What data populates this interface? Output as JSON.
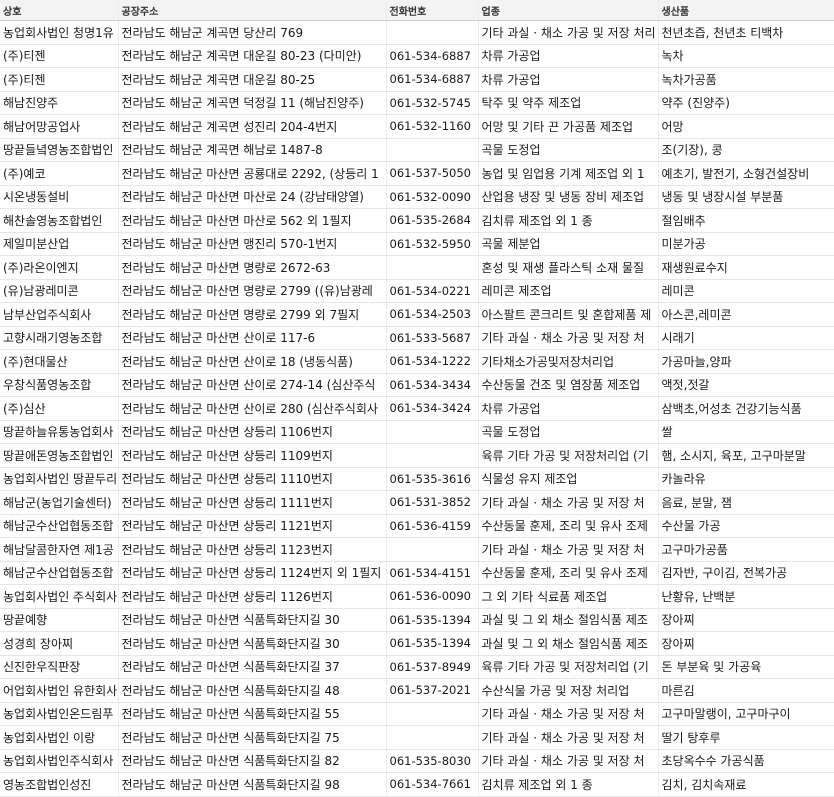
{
  "headers": [
    "상호",
    "공장주소",
    "전화번호",
    "업종",
    "생산품"
  ],
  "rows": [
    [
      "농업회사법인 청명1유",
      "전라남도 해남군 계곡면 당산리 769",
      "",
      "기타 과실 · 채소 가공 및 저장 처리",
      "천년초즙, 천년초 티백차"
    ],
    [
      "(주)티젠",
      "전라남도 해남군 계곡면 대운길 80-23 (다미안)",
      "061-534-6887",
      "차류 가공업",
      "녹차"
    ],
    [
      "(주)티젠",
      "전라남도 해남군 계곡면 대운길 80-25",
      "061-534-6887",
      "차류 가공업",
      "녹차가공품"
    ],
    [
      "해남진양주",
      "전라남도 해남군 계곡면 덕정길 11 (해남진양주)",
      "061-532-5745",
      "탁주 및 약주 제조업",
      "약주 (진양주)"
    ],
    [
      "해남어망공업사",
      "전라남도 해남군 계곡면 성진리 204-4번지",
      "061-532-1160",
      "어망 및 기타 끈 가공품 제조업",
      "어망"
    ],
    [
      "땅끝들녘영농조합법인",
      "전라남도 해남군 계곡면 해남로 1487-8",
      "",
      "곡물 도정업",
      "조(기장), 콩"
    ],
    [
      "(주)예코",
      "전라남도 해남군 마산면 공룡대로 2292, (상등리 1",
      "061-537-5050",
      "농업 및 임업용 기계 제조업 외 1",
      "예초기, 발전기, 소형건설장비"
    ],
    [
      "시온냉동설비",
      "전라남도 해남군 마산면 마산로 24 (강남태양열)",
      "061-532-0090",
      "산업용 냉장 및 냉동 장비 제조업",
      "냉동 및 냉장시설 부분품"
    ],
    [
      "해찬솔영농조합법인",
      "전라남도 해남군 마산면 마산로 562 외 1필지",
      "061-535-2684",
      "김치류 제조업 외 1 종",
      "절임배추"
    ],
    [
      "제일미분산업",
      "전라남도 해남군 마산면 맹진리 570-1번지",
      "061-532-5950",
      "곡물 제분업",
      "미분가공"
    ],
    [
      "(주)라온이엔지",
      "전라남도 해남군 마산면 명량로 2672-63",
      "",
      "혼성 및 재생 플라스틱 소재 물질",
      "재생원료수지"
    ],
    [
      "(유)남광레미콘",
      "전라남도 해남군 마산면 명량로 2799 ((유)남광레",
      "061-534-0221",
      "레미콘 제조업",
      "레미콘"
    ],
    [
      "남부산업주식회사",
      "전라남도 해남군 마산면 명량로 2799 외 7필지",
      "061-534-2503",
      "아스팔트 콘크리트 및 혼합제품 제",
      "아스콘,레미콘"
    ],
    [
      "고향시래기영농조합",
      "전라남도 해남군 마산면 산이로 117-6",
      "061-533-5687",
      "기타 과실 · 채소 가공 및 저장 처",
      "시래기"
    ],
    [
      "(주)현대물산",
      "전라남도 해남군 마산면 산이로 18 (냉동식품)",
      "061-534-1222",
      "기타채소가공및저장처리업",
      "가공마늘,양파"
    ],
    [
      "우창식품영농조합",
      "전라남도 해남군 마산면 산이로 274-14 (심산주식",
      "061-534-3434",
      "수산동물 건조 및 염장품 제조업",
      "액젓,젓갈"
    ],
    [
      "(주)심산",
      "전라남도 해남군 마산면 산이로 280 (심산주식회사",
      "061-534-3424",
      "차류 가공업",
      "삼백초,어성초 건강기능식품"
    ],
    [
      "땅끝하늘유통농업회사",
      "전라남도 해남군 마산면 상등리 1106번지",
      "",
      "곡물 도정업",
      "쌀"
    ],
    [
      "땅끝애돈영농조합법인",
      "전라남도 해남군 마산면 상등리 1109번지",
      "",
      "육류 기타 가공 및 저장처리업 (기",
      "햄, 소시지, 육포, 고구마분말"
    ],
    [
      "농업회사법인 땅끝두리",
      "전라남도 해남군 마산면 상등리 1110번지",
      "061-535-3616",
      "식물성 유지 제조업",
      "카놀라유"
    ],
    [
      "해남군(농업기술센터)",
      "전라남도 해남군 마산면 상등리 1111번지",
      "061-531-3852",
      "기타 과실 · 채소 가공 및 저장 처",
      "음료, 분말, 잼"
    ],
    [
      "해남군수산업협동조합",
      "전라남도 해남군 마산면 상등리 1121번지",
      "061-536-4159",
      "수산동물 훈제, 조리 및 유사 조제",
      "수산물 가공"
    ],
    [
      "해남달콤한자연 제1공",
      "전라남도 해남군 마산면 상등리 1123번지",
      "",
      "기타 과실 · 채소 가공 및 저장 처",
      "고구마가공품"
    ],
    [
      "해남군수산업협동조합",
      "전라남도 해남군 마산면 상등리 1124번지 외 1필지",
      "061-534-4151",
      "수산동물 훈제, 조리 및 유사 조제",
      "김자반, 구이김, 전복가공"
    ],
    [
      "농업회사법인 주식회사",
      "전라남도 해남군 마산면 상등리 1126번지",
      "061-536-0090",
      "그 외 기타 식료품 제조업",
      "난황유, 난백분"
    ],
    [
      "땅끝예향",
      "전라남도 해남군 마산면 식품특화단지길 30",
      "061-535-1394",
      "과실 및 그 외 채소 절임식품 제조",
      "장아찌"
    ],
    [
      "성경희 장아찌",
      "전라남도 해남군 마산면 식품특화단지길 30",
      "061-535-1394",
      "과실 및 그 외 채소 절임식품 제조",
      "장아찌"
    ],
    [
      "신진한우직판장",
      "전라남도 해남군 마산면 식품특화단지길 37",
      "061-537-8949",
      "육류 기타 가공 및 저장처리업 (기",
      "돈 부분육 및 가공육"
    ],
    [
      "어업회사법인 유한회사",
      "전라남도 해남군 마산면 식품특화단지길 48",
      "061-537-2021",
      "수산식물 가공 및 저장 처리업",
      "마른김"
    ],
    [
      "농업회사법인온드림푸",
      "전라남도 해남군 마산면 식품특화단지길 55",
      "",
      "기타 과실 · 채소 가공 및 저장 처",
      "고구마말랭이, 고구마구이"
    ],
    [
      "농업회사법인 이랑",
      "전라남도 해남군 마산면 식품특화단지길 75",
      "",
      "기타 과실 · 채소 가공 및 저장 처",
      "딸기 탕후루"
    ],
    [
      "농업회사법인주식회사",
      "전라남도 해남군 마산면 식품특화단지길 82",
      "061-535-8030",
      "기타 과실 · 채소 가공 및 저장 처",
      "초당옥수수 가공식품"
    ],
    [
      "영농조합법인성진",
      "전라남도 해남군 마산면 식품특화단지길 98",
      "061-534-7661",
      "김치류 제조업 외 1 종",
      "김치, 김치속재료"
    ]
  ]
}
